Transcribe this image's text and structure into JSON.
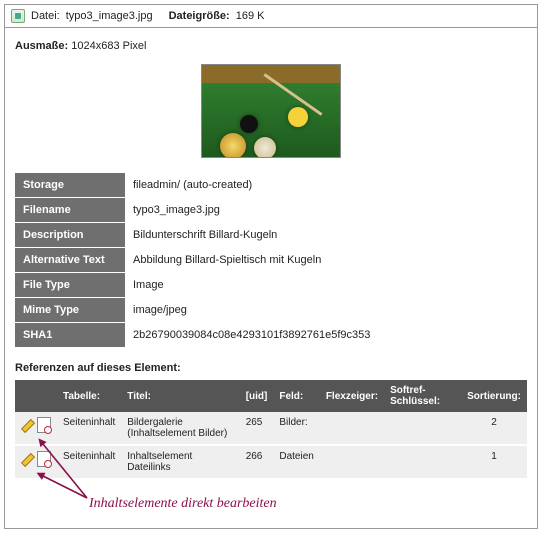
{
  "header": {
    "file_label": "Datei:",
    "filename": "typo3_image3.jpg",
    "size_label": "Dateigröße:",
    "size_value": "169 K"
  },
  "dimensions": {
    "label": "Ausmaße:",
    "value": "1024x683 Pixel"
  },
  "meta": {
    "rows": [
      {
        "k": "Storage",
        "v": "fileadmin/ (auto-created)"
      },
      {
        "k": "Filename",
        "v": "typo3_image3.jpg"
      },
      {
        "k": "Description",
        "v": "Bildunterschrift Billard-Kugeln"
      },
      {
        "k": "Alternative Text",
        "v": "Abbildung Billard-Spieltisch mit Kugeln"
      },
      {
        "k": "File Type",
        "v": "Image"
      },
      {
        "k": "Mime Type",
        "v": "image/jpeg"
      },
      {
        "k": "SHA1",
        "v": "2b26790039084c08e4293101f3892761e5f9c353"
      }
    ]
  },
  "references": {
    "heading": "Referenzen auf dieses Element:",
    "columns": {
      "table": "Tabelle:",
      "title": "Titel:",
      "uid": "[uid]",
      "field": "Feld:",
      "flex": "Flexzeiger:",
      "softref": "Softref-Schlüssel:",
      "sort": "Sortierung:"
    },
    "rows": [
      {
        "table": "Seiteninhalt",
        "title": "Bildergalerie (Inhaltselement Bilder)",
        "uid": "265",
        "field": "Bilder:",
        "flex": "",
        "softref": "",
        "sort": "2"
      },
      {
        "table": "Seiteninhalt",
        "title": "Inhaltselement Dateilinks",
        "uid": "266",
        "field": "Dateien",
        "flex": "",
        "softref": "",
        "sort": "1"
      }
    ]
  },
  "annotation": "Inhaltselemente direkt bearbeiten"
}
